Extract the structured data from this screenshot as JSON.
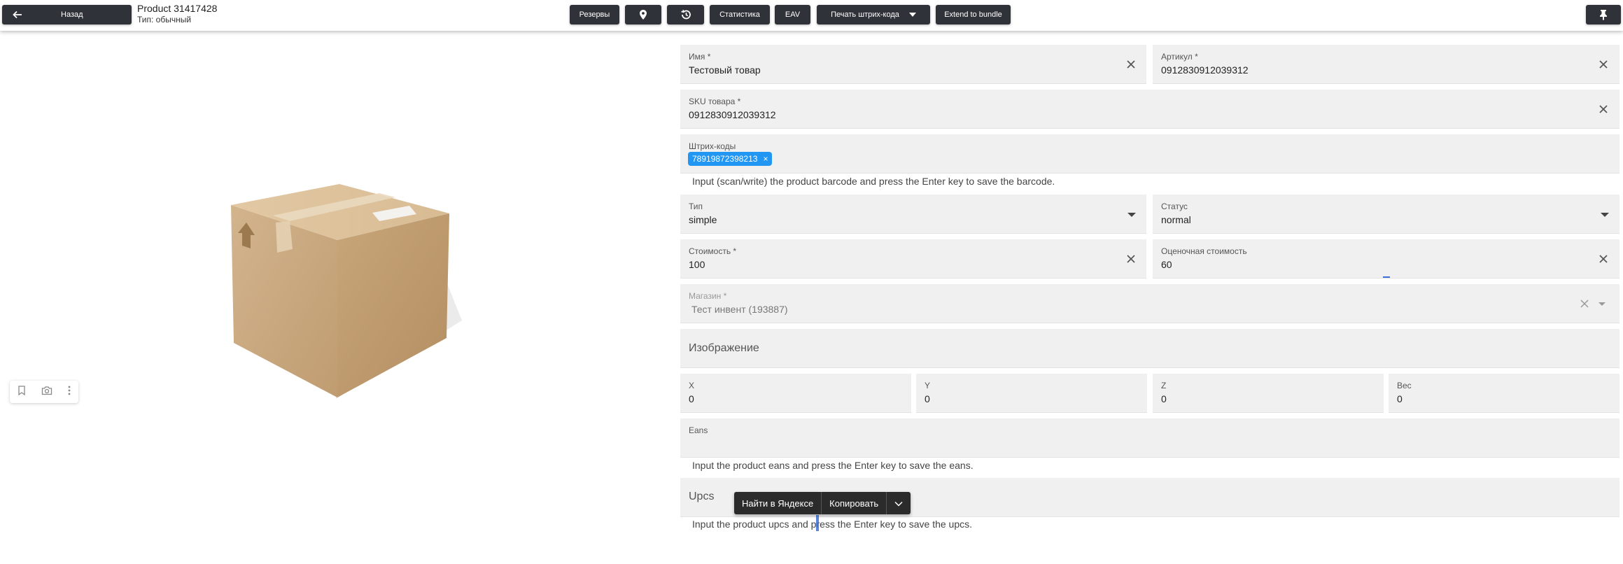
{
  "header": {
    "back_label": "Назад",
    "title": "Product 31417428",
    "subtitle": "Тип: обычный",
    "reserves_label": "Резервы",
    "stats_label": "Статистика",
    "eav_label": "EAV",
    "print_barcode_label": "Печать штрих-кода",
    "extend_label": "Extend to bundle"
  },
  "form": {
    "name": {
      "label": "Имя *",
      "value": "Тестовый товар"
    },
    "article": {
      "label": "Артикул *",
      "value": "0912830912039312"
    },
    "sku": {
      "label": "SKU товара *",
      "value": "0912830912039312"
    },
    "barcodes": {
      "label": "Штрих-коды",
      "chip": "78919872398213",
      "chip_remove": "×",
      "hint": "Input (scan/write) the product barcode and press the Enter key to save the barcode."
    },
    "type": {
      "label": "Тип",
      "value": "simple"
    },
    "status": {
      "label": "Статус",
      "value": "normal"
    },
    "cost": {
      "label": "Стоимость *",
      "value": "100"
    },
    "estimated_cost": {
      "label": "Оценочная стоимость",
      "value": "60"
    },
    "shop": {
      "label": "Магазин *",
      "value": "Тест инвент (193887)"
    },
    "image": {
      "placeholder": "Изображение"
    },
    "x": {
      "label": "X",
      "value": "0"
    },
    "y": {
      "label": "Y",
      "value": "0"
    },
    "z": {
      "label": "Z",
      "value": "0"
    },
    "weight": {
      "label": "Вес",
      "value": "0"
    },
    "eans": {
      "label": "Eans",
      "hint": "Input the product eans and press the Enter key to save the eans."
    },
    "upcs": {
      "placeholder": "Upcs",
      "hint": "Input the product upcs and press the Enter key to save the upcs."
    }
  },
  "context_menu": {
    "search_label": "Найти в Яндексе",
    "copy_label": "Копировать"
  },
  "colors": {
    "toolbar_button": "#2f3339",
    "chip": "#2196f3",
    "field_bg": "#f0f0f0"
  }
}
